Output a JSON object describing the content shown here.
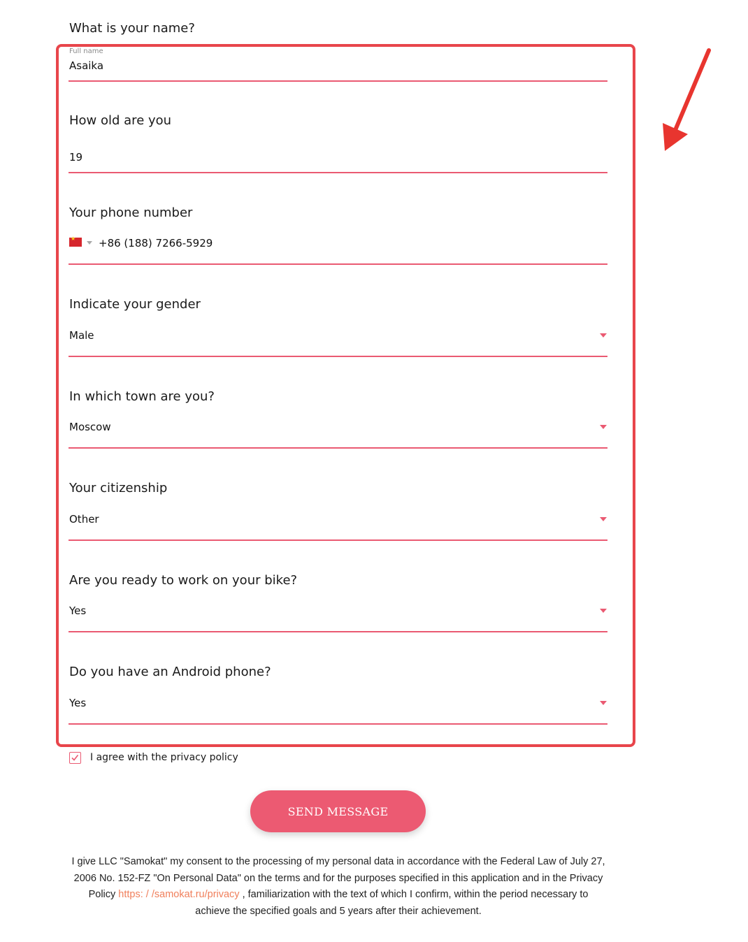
{
  "form": {
    "name_question": "What is your name?",
    "name_small_label": "Full name",
    "name_value": "Asaika",
    "age_question": "How old are you",
    "age_value": "19",
    "phone_question": "Your phone number",
    "phone_flag_icon": "china-flag-icon",
    "phone_value": "+86 (188) 7266-5929",
    "gender_question": "Indicate your gender",
    "gender_value": "Male",
    "town_question": "In which town are you?",
    "town_value": "Moscow",
    "citizenship_question": "Your citizenship",
    "citizenship_value": "Other",
    "bike_question": "Are you ready to work on your bike?",
    "bike_value": "Yes",
    "android_question": "Do you have an Android phone?",
    "android_value": "Yes"
  },
  "agreement": {
    "label": "I agree with the privacy policy",
    "checked": true
  },
  "send_button": "SEND MESSAGE",
  "consent": {
    "text_before": "I give LLC \"Samokat\" my consent to the processing of my personal data in accordance with the Federal Law of July 27, 2006 No. 152-FZ \"On Personal Data\" on the terms and for the purposes specified in this application and in the Privacy Policy",
    "link": "https: / /samokat.ru/privacy",
    "text_after": ", familiarization with the text of which I confirm, within the period necessary to achieve the specified goals and 5 years after their achievement."
  },
  "colors": {
    "accent": "#ea5a72",
    "highlight_border": "#e8454b",
    "button_bg": "#ec5a72",
    "link": "#f07f5b"
  }
}
